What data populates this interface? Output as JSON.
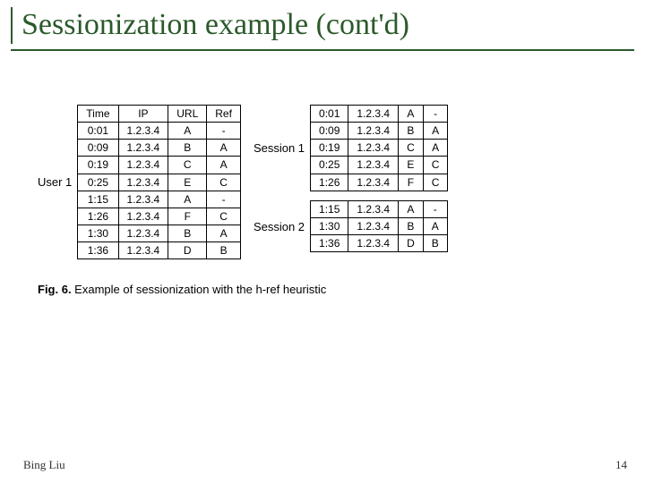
{
  "title": "Sessionization example (cont'd)",
  "author": "Bing Liu",
  "page_number": "14",
  "caption_label": "Fig. 6.",
  "caption_text": " Example of sessionization with the h-ref heuristic",
  "user_label": "User 1",
  "user_table": {
    "headers": [
      "Time",
      "IP",
      "URL",
      "Ref"
    ],
    "rows": [
      [
        "0:01",
        "1.2.3.4",
        "A",
        "-"
      ],
      [
        "0:09",
        "1.2.3.4",
        "B",
        "A"
      ],
      [
        "0:19",
        "1.2.3.4",
        "C",
        "A"
      ],
      [
        "0:25",
        "1.2.3.4",
        "E",
        "C"
      ],
      [
        "1:15",
        "1.2.3.4",
        "A",
        "-"
      ],
      [
        "1:26",
        "1.2.3.4",
        "F",
        "C"
      ],
      [
        "1:30",
        "1.2.3.4",
        "B",
        "A"
      ],
      [
        "1:36",
        "1.2.3.4",
        "D",
        "B"
      ]
    ]
  },
  "sessions": [
    {
      "label": "Session 1",
      "rows": [
        [
          "0:01",
          "1.2.3.4",
          "A",
          "-"
        ],
        [
          "0:09",
          "1.2.3.4",
          "B",
          "A"
        ],
        [
          "0:19",
          "1.2.3.4",
          "C",
          "A"
        ],
        [
          "0:25",
          "1.2.3.4",
          "E",
          "C"
        ],
        [
          "1:26",
          "1.2.3.4",
          "F",
          "C"
        ]
      ]
    },
    {
      "label": "Session 2",
      "rows": [
        [
          "1:15",
          "1.2.3.4",
          "A",
          "-"
        ],
        [
          "1:30",
          "1.2.3.4",
          "B",
          "A"
        ],
        [
          "1:36",
          "1.2.3.4",
          "D",
          "B"
        ]
      ]
    }
  ]
}
